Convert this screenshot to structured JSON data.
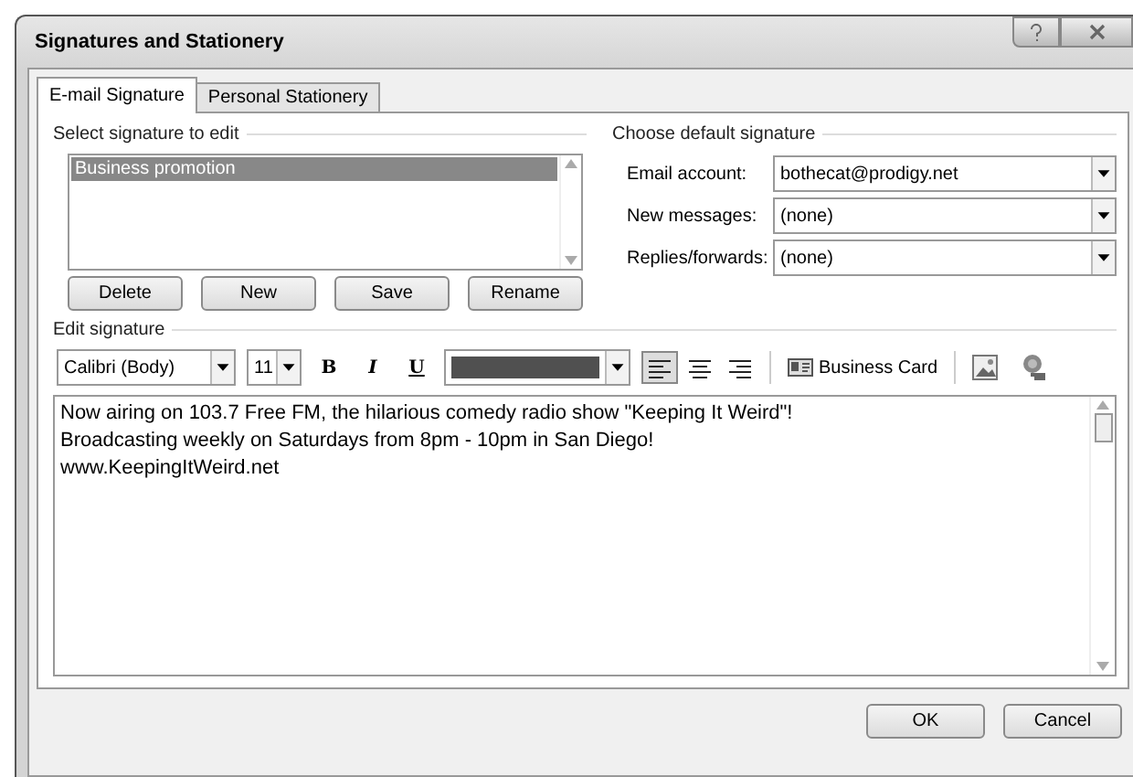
{
  "window": {
    "title": "Signatures and Stationery"
  },
  "tabs": [
    {
      "label": "E-mail Signature",
      "selected": true
    },
    {
      "label": "Personal Stationery",
      "selected": false
    }
  ],
  "select_signature": {
    "heading": "Select signature to edit",
    "items": [
      {
        "label": "Business promotion",
        "selected": true
      }
    ],
    "buttons": [
      "Delete",
      "New",
      "Save",
      "Rename"
    ]
  },
  "default_signature": {
    "heading": "Choose default signature",
    "fields": [
      {
        "label": "Email account:",
        "value": "bothecat@prodigy.net"
      },
      {
        "label": "New messages:",
        "value": "(none)"
      },
      {
        "label": "Replies/forwards:",
        "value": "(none)"
      }
    ]
  },
  "edit_signature": {
    "heading": "Edit signature",
    "font": "Calibri (Body)",
    "size": "11",
    "bold_label": "B",
    "italic_label": "I",
    "underline_label": "U",
    "align": [
      {
        "kind": "left",
        "selected": true
      },
      {
        "kind": "center",
        "selected": false
      },
      {
        "kind": "right",
        "selected": false
      }
    ],
    "business_card": "Business Card",
    "lines": [
      "Now airing on 103.7 Free FM, the hilarious comedy radio show \"Keeping It Weird\"!",
      "Broadcasting weekly on Saturdays from 8pm - 10pm in San Diego!",
      "www.KeepingItWeird.net"
    ]
  },
  "buttons": [
    "OK",
    "Cancel"
  ]
}
